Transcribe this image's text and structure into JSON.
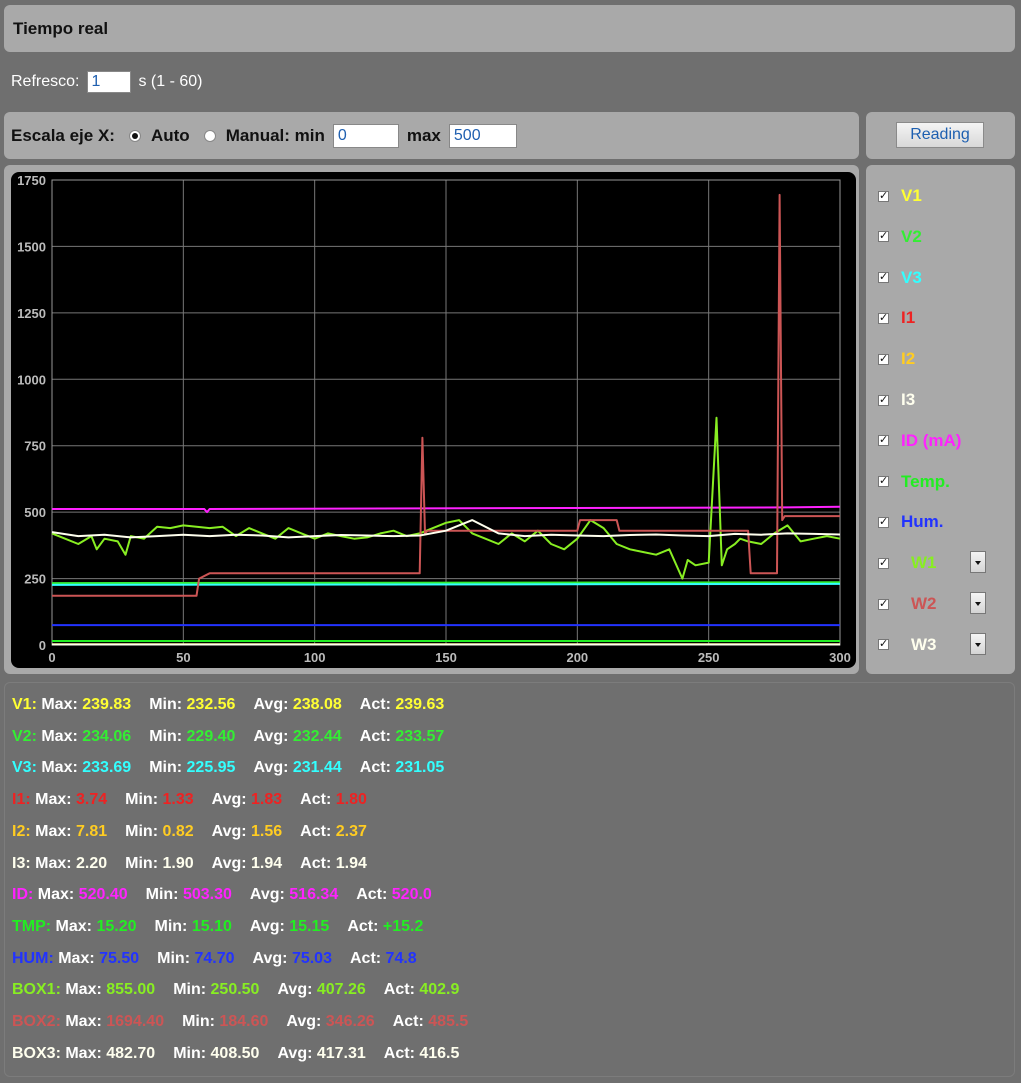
{
  "title": "Tiempo real",
  "refresh": {
    "label": "Refresco:",
    "value": "1",
    "unit": "s (1 - 60)"
  },
  "scale": {
    "label": "Escala eje X:",
    "auto_label": "Auto",
    "manual_label": "Manual: min",
    "min_value": "0",
    "max_label": "max",
    "max_value": "500",
    "selected": "auto"
  },
  "reading_button": "Reading",
  "legend": [
    {
      "label": "V1",
      "color": "#ffff33",
      "dropdown": false
    },
    {
      "label": "V2",
      "color": "#33ee33",
      "dropdown": false
    },
    {
      "label": "V3",
      "color": "#33ffff",
      "dropdown": false
    },
    {
      "label": "I1",
      "color": "#ee2222",
      "dropdown": false
    },
    {
      "label": "I2",
      "color": "#ffcc22",
      "dropdown": false
    },
    {
      "label": "I3",
      "color": "#ffffee",
      "dropdown": false
    },
    {
      "label": "ID (mA)",
      "color": "#ff22ff",
      "dropdown": false
    },
    {
      "label": "Temp.",
      "color": "#22ee22",
      "dropdown": false
    },
    {
      "label": "Hum.",
      "color": "#2233ff",
      "dropdown": false
    },
    {
      "label": "W1",
      "color": "#88ee22",
      "dropdown": true
    },
    {
      "label": "W2",
      "color": "#cc5555",
      "dropdown": true
    },
    {
      "label": "W3",
      "color": "#ffffee",
      "dropdown": true
    }
  ],
  "chart_data": {
    "type": "line",
    "xlim": [
      0,
      300
    ],
    "ylim": [
      0,
      1750
    ],
    "xticks": [
      "0",
      "50",
      "100",
      "150",
      "200",
      "250",
      "300"
    ],
    "yticks": [
      "0",
      "250",
      "500",
      "750",
      "1000",
      "1250",
      "1500",
      "1750"
    ],
    "grid": true,
    "series": [
      {
        "name": "V1",
        "color": "#ffff33",
        "x": [
          0,
          300
        ],
        "y": [
          3,
          3
        ]
      },
      {
        "name": "V2",
        "color": "#33ee33",
        "x": [
          0,
          300
        ],
        "y": [
          233,
          236
        ]
      },
      {
        "name": "V3",
        "color": "#33ffff",
        "x": [
          0,
          300
        ],
        "y": [
          226,
          230
        ]
      },
      {
        "name": "Temp.",
        "color": "#22ee22",
        "x": [
          0,
          300
        ],
        "y": [
          15,
          15
        ]
      },
      {
        "name": "Hum.",
        "color": "#2233ff",
        "x": [
          0,
          300
        ],
        "y": [
          75,
          75
        ]
      },
      {
        "name": "ID (mA)",
        "color": "#ff22ff",
        "x": [
          0,
          58,
          59,
          60,
          280,
          300
        ],
        "y": [
          512,
          512,
          500,
          512,
          518,
          520
        ]
      },
      {
        "name": "W1",
        "color": "#88ee22",
        "x": [
          0,
          5,
          10,
          15,
          17,
          20,
          25,
          28,
          30,
          35,
          40,
          45,
          50,
          55,
          60,
          65,
          70,
          75,
          80,
          85,
          90,
          95,
          100,
          105,
          110,
          115,
          120,
          125,
          130,
          135,
          140,
          145,
          150,
          155,
          160,
          165,
          170,
          175,
          180,
          185,
          190,
          195,
          200,
          205,
          210,
          215,
          220,
          225,
          230,
          235,
          240,
          242,
          245,
          250,
          253,
          255,
          257,
          260,
          262,
          265,
          270,
          275,
          280,
          285,
          290,
          295,
          300
        ],
        "y": [
          420,
          400,
          380,
          410,
          360,
          400,
          390,
          340,
          410,
          400,
          445,
          440,
          450,
          445,
          440,
          445,
          410,
          440,
          420,
          400,
          440,
          420,
          400,
          420,
          410,
          400,
          405,
          420,
          430,
          410,
          420,
          440,
          460,
          470,
          420,
          400,
          380,
          420,
          390,
          430,
          380,
          360,
          400,
          470,
          440,
          380,
          360,
          350,
          340,
          360,
          250,
          320,
          300,
          310,
          855,
          300,
          360,
          380,
          400,
          390,
          380,
          420,
          450,
          390,
          400,
          410,
          400
        ]
      },
      {
        "name": "W2",
        "color": "#cc5555",
        "x": [
          0,
          55,
          56,
          60,
          140,
          141,
          142,
          143,
          144,
          160,
          200,
          201,
          215,
          216,
          265,
          266,
          276,
          277,
          278,
          279,
          280,
          300
        ],
        "y": [
          185,
          185,
          250,
          270,
          270,
          780,
          420,
          430,
          430,
          430,
          430,
          470,
          470,
          430,
          430,
          270,
          270,
          1694,
          470,
          485,
          485,
          485
        ]
      },
      {
        "name": "W3",
        "color": "#ffffee",
        "x": [
          0,
          10,
          20,
          30,
          40,
          50,
          60,
          70,
          80,
          90,
          100,
          110,
          120,
          130,
          140,
          150,
          160,
          170,
          180,
          190,
          200,
          210,
          220,
          230,
          240,
          250,
          260,
          270,
          280,
          290,
          300
        ],
        "y": [
          425,
          410,
          415,
          405,
          410,
          415,
          410,
          415,
          412,
          405,
          410,
          414,
          412,
          410,
          412,
          430,
          470,
          420,
          410,
          415,
          412,
          410,
          414,
          416,
          412,
          410,
          418,
          415,
          420,
          418,
          416
        ]
      },
      {
        "name": "I1",
        "color": "#ee2222",
        "x": [
          0,
          300
        ],
        "y": [
          2,
          2
        ]
      },
      {
        "name": "I2",
        "color": "#ffcc22",
        "x": [
          0,
          300
        ],
        "y": [
          2,
          2
        ]
      },
      {
        "name": "I3",
        "color": "#ffffee",
        "x": [
          0,
          300
        ],
        "y": [
          2,
          2
        ]
      }
    ]
  },
  "stats": [
    {
      "label": "V1:",
      "color": "#ffff33",
      "max": "239.83",
      "min": "232.56",
      "avg": "238.08",
      "act": "239.63"
    },
    {
      "label": "V2:",
      "color": "#33ee33",
      "max": "234.06",
      "min": "229.40",
      "avg": "232.44",
      "act": "233.57"
    },
    {
      "label": "V3:",
      "color": "#33ffff",
      "max": "233.69",
      "min": "225.95",
      "avg": "231.44",
      "act": "231.05"
    },
    {
      "label": "I1:",
      "color": "#ee2222",
      "max": "3.74",
      "min": "1.33",
      "avg": "1.83",
      "act": "1.80"
    },
    {
      "label": "I2:",
      "color": "#ffcc22",
      "max": "7.81",
      "min": "0.82",
      "avg": "1.56",
      "act": "2.37"
    },
    {
      "label": "I3:",
      "color": "#ffffee",
      "max": "2.20",
      "min": "1.90",
      "avg": "1.94",
      "act": "1.94"
    },
    {
      "label": "ID:",
      "color": "#ff22ff",
      "max": "520.40",
      "min": "503.30",
      "avg": "516.34",
      "act": "520.0"
    },
    {
      "label": "TMP:",
      "color": "#22ee22",
      "max": "15.20",
      "min": "15.10",
      "avg": "15.15",
      "act": "+15.2"
    },
    {
      "label": "HUM:",
      "color": "#2233ff",
      "max": "75.50",
      "min": "74.70",
      "avg": "75.03",
      "act": "74.8"
    },
    {
      "label": "BOX1:",
      "color": "#88ee22",
      "max": "855.00",
      "min": "250.50",
      "avg": "407.26",
      "act": "402.9"
    },
    {
      "label": "BOX2:",
      "color": "#cc5555",
      "max": "1694.40",
      "min": "184.60",
      "avg": "346.26",
      "act": "485.5"
    },
    {
      "label": "BOX3:",
      "color": "#ffffee",
      "max": "482.70",
      "min": "408.50",
      "avg": "417.31",
      "act": "416.5"
    }
  ],
  "stat_labels": {
    "max": "Max:",
    "min": "Min:",
    "avg": "Avg:",
    "act": "Act:"
  }
}
